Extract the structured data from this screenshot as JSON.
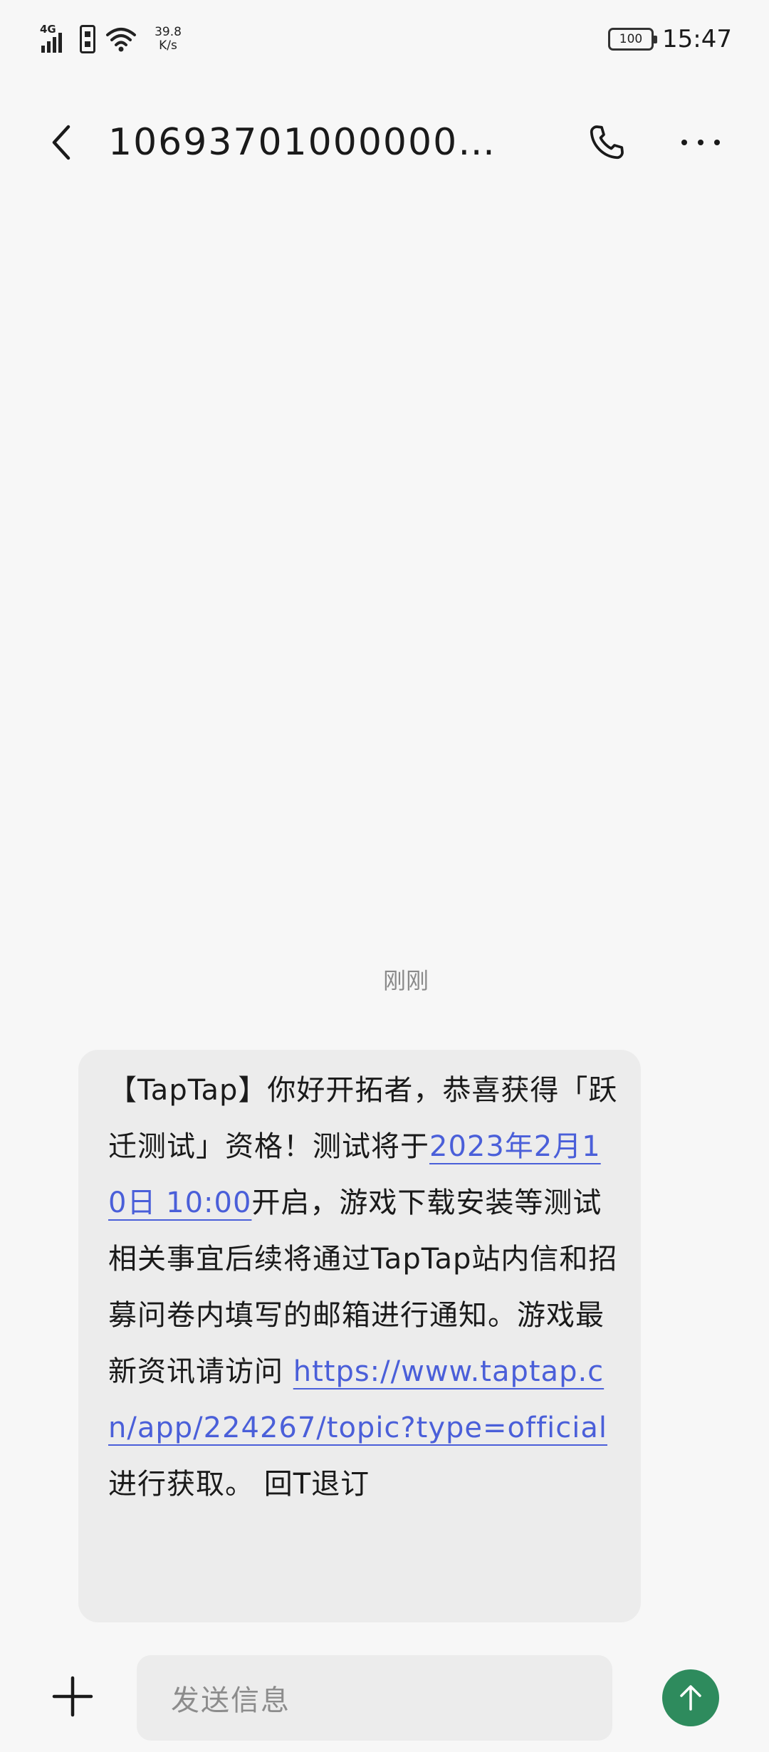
{
  "status_bar": {
    "network_type": "4G",
    "speed_value": "39.8",
    "speed_unit": "K/s",
    "battery_level": "100",
    "time": "15:47"
  },
  "header": {
    "contact": "10693701000000…",
    "icons": {
      "back": "chevron-left-icon",
      "call": "phone-icon",
      "more": "more-horizontal-icon"
    }
  },
  "conversation": {
    "timestamp": "刚刚",
    "message": {
      "part1": "【TapTap】你好开拓者，恭喜获得「跃迁测试」资格！测试将于",
      "date_link": "2023年2月10日 10:00",
      "part2": "开启，游戏下载安装等测试相关事宜后续将通过TapTap站内信和招募问卷内填写的邮箱进行通知。游戏最新资讯请访问 ",
      "url_link": "https://www.taptap.cn/app/224267/topic?type=official",
      "part3": " 进行获取。 回T退订"
    }
  },
  "composer": {
    "placeholder": "发送信息",
    "icons": {
      "add": "plus-icon",
      "send": "arrow-up-icon"
    }
  },
  "colors": {
    "background": "#f7f7f7",
    "bubble": "#ececec",
    "link": "#4a5fd9",
    "send_button": "#2e8b5d"
  }
}
